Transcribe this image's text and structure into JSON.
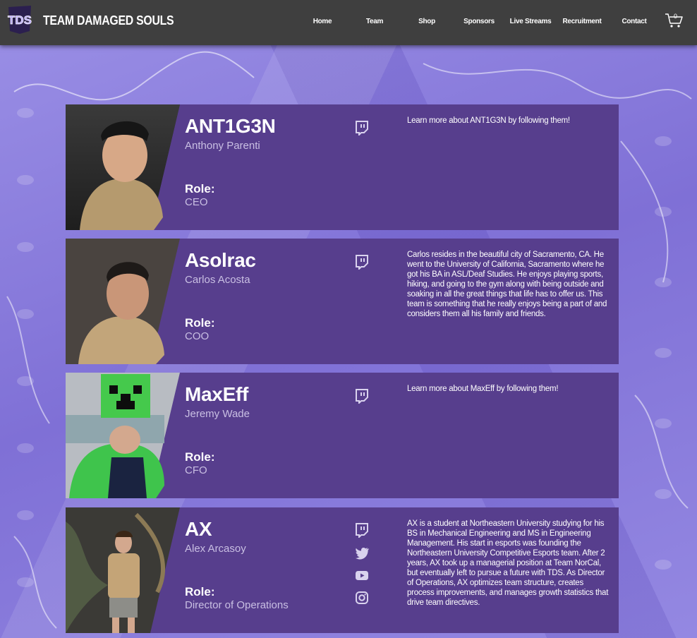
{
  "header": {
    "brand": "TEAM DAMAGED SOULS",
    "logo_text": "TDS",
    "nav": [
      "Home",
      "Team",
      "Shop",
      "Sponsors",
      "Live Streams",
      "Recruitment",
      "Contact"
    ],
    "cart_count": "0"
  },
  "colors": {
    "header_bg": "#3f3f3f",
    "card_bg": "#573e8d",
    "page_bg": "#8c7fdc",
    "muted_text": "#c9bfe3"
  },
  "members": [
    {
      "handle": "ANT1G3N",
      "name": "Anthony Parenti",
      "role_label": "Role:",
      "role": "CEO",
      "socials": [
        "twitch-icon"
      ],
      "bio": "Learn more about ANT1G3N by following them!"
    },
    {
      "handle": "Asolrac",
      "name": "Carlos Acosta",
      "role_label": "Role:",
      "role": "COO",
      "socials": [
        "twitch-icon"
      ],
      "bio": "Carlos resides in the beautiful city of Sacramento, CA. He went to the University of California, Sacramento where he got his BA in ASL/Deaf Studies. He enjoys playing sports, hiking, and going to the gym along with being outside and soaking in all the great things that life has to offer us. This team is something that he really enjoys being a part of and considers them all his family and friends."
    },
    {
      "handle": "MaxEff",
      "name": "Jeremy Wade",
      "role_label": "Role:",
      "role": "CFO",
      "socials": [
        "twitch-icon"
      ],
      "bio": "Learn more about MaxEff by following them!"
    },
    {
      "handle": "AX",
      "name": "Alex Arcasoy",
      "role_label": "Role:",
      "role": "Director of Operations",
      "socials": [
        "twitch-icon",
        "twitter-icon",
        "youtube-icon",
        "instagram-icon"
      ],
      "bio": "AX is a student at Northeastern University studying for his BS in Mechanical Engineering and MS in Engineering Management. His start in esports was founding the Northeastern University Competitive Esports team. After 2 years, AX took up a managerial position at Team NorCal, but eventually left to pursue a future with TDS. As Director of Operations, AX optimizes team structure, creates process improvements, and manages growth statistics that drive team directives."
    }
  ]
}
